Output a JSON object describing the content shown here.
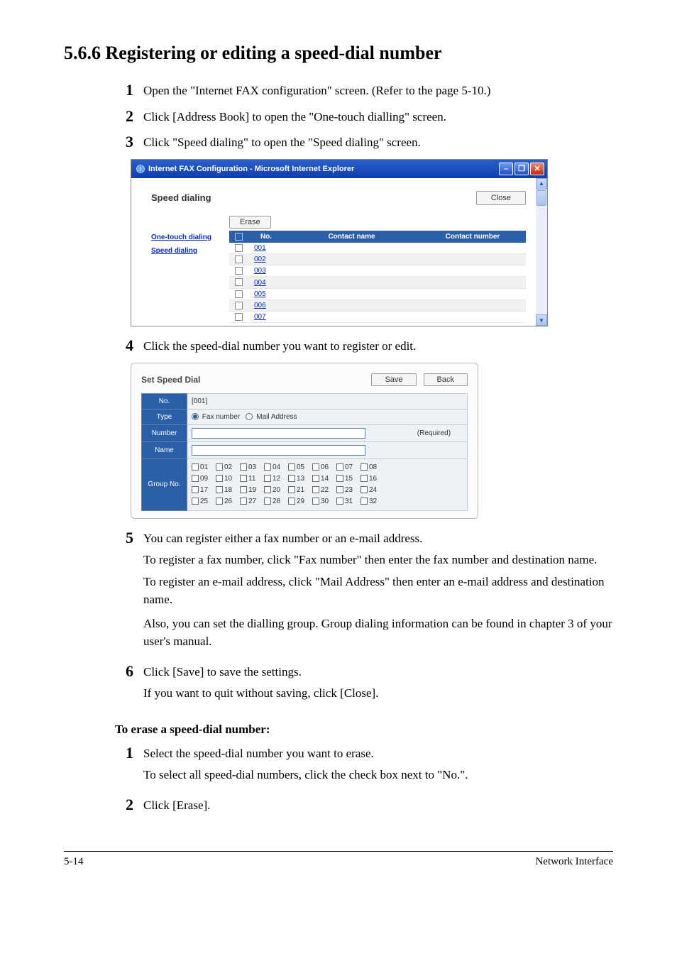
{
  "heading": "5.6.6 Registering or editing a speed-dial number",
  "steps_a": [
    {
      "num": "1",
      "text": "Open the \"Internet FAX configuration\" screen. (Refer to the page 5-10.)"
    },
    {
      "num": "2",
      "text": "Click [Address Book] to open the \"One-touch dialling\" screen."
    },
    {
      "num": "3",
      "text": "Click \"Speed dialing\" to open the \"Speed dialing\" screen."
    }
  ],
  "screenshot1": {
    "window_title": "Internet FAX Configuration - Microsoft Internet Explorer",
    "page_title": "Speed dialing",
    "close_btn": "Close",
    "erase_btn": "Erase",
    "side_links": [
      "One-touch dialing",
      "Speed dialing"
    ],
    "columns": [
      "No.",
      "Contact name",
      "Contact number"
    ],
    "rows": [
      {
        "no": "001"
      },
      {
        "no": "002"
      },
      {
        "no": "003"
      },
      {
        "no": "004"
      },
      {
        "no": "005"
      },
      {
        "no": "006"
      },
      {
        "no": "007"
      }
    ]
  },
  "step4": {
    "num": "4",
    "text": "Click the speed-dial number you want to register or edit."
  },
  "screenshot2": {
    "title": "Set Speed Dial",
    "save_btn": "Save",
    "back_btn": "Back",
    "labels": {
      "no": "No.",
      "type": "Type",
      "number": "Number",
      "name": "Name",
      "group": "Group No."
    },
    "values": {
      "no": "[001]",
      "type_fax": "Fax number",
      "type_mail": "Mail Address",
      "required": "(Required)"
    },
    "groups": [
      "01",
      "02",
      "03",
      "04",
      "05",
      "06",
      "07",
      "08",
      "09",
      "10",
      "11",
      "12",
      "13",
      "14",
      "15",
      "16",
      "17",
      "18",
      "19",
      "20",
      "21",
      "22",
      "23",
      "24",
      "25",
      "26",
      "27",
      "28",
      "29",
      "30",
      "31",
      "32"
    ]
  },
  "step5": {
    "num": "5",
    "p1": "You can register either a fax number or an e-mail address.",
    "p2": "To register a fax number, click \"Fax number\" then enter the fax number and destination name.",
    "p3": "To register an e-mail address, click \"Mail Address\" then enter an e-mail address and destination name.",
    "p4": "Also, you can set the dialling group. Group dialing information can be found in chapter 3 of your user's manual."
  },
  "step6": {
    "num": "6",
    "p1": "Click [Save] to save the settings.",
    "p2": "If you want to quit without saving, click [Close]."
  },
  "erase_heading": "To erase a speed-dial number:",
  "erase_steps": [
    {
      "num": "1",
      "p1": "Select the speed-dial number you want to erase.",
      "p2": "To select all speed-dial numbers, click the check box next to \"No.\"."
    },
    {
      "num": "2",
      "p1": "Click [Erase]."
    }
  ],
  "footer_left": "5-14",
  "footer_right": "Network Interface"
}
